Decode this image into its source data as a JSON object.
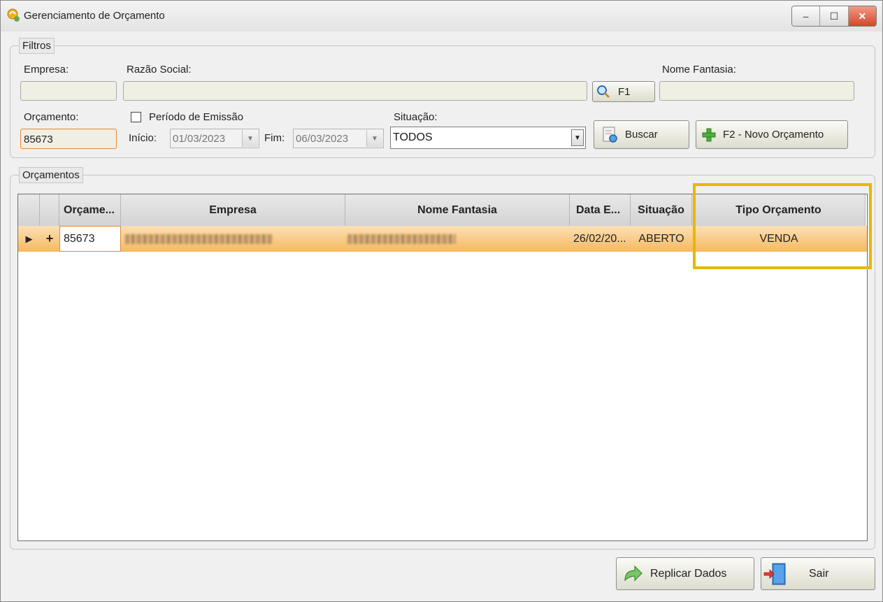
{
  "window": {
    "title": "Gerenciamento de Orçamento",
    "controls": {
      "minimize": "–",
      "maximize": "☐",
      "close": "✕"
    }
  },
  "filtros": {
    "legend": "Filtros",
    "empresa_label": "Empresa:",
    "empresa_value": "",
    "razao_social_label": "Razão Social:",
    "razao_social_value": "",
    "search_button_label": "F1",
    "nome_fantasia_label": "Nome Fantasia:",
    "nome_fantasia_value": "",
    "orcamento_label": "Orçamento:",
    "orcamento_value": "85673",
    "periodo_label": "Período de Emissão",
    "periodo_checked": false,
    "inicio_label": "Início:",
    "inicio_value": "01/03/2023",
    "fim_label": "Fim:",
    "fim_value": "06/03/2023",
    "situacao_label": "Situação:",
    "situacao_value": "TODOS",
    "buscar_label": "Buscar",
    "novo_label": "F2 - Novo Orçamento"
  },
  "orcamentos": {
    "legend": "Orçamentos",
    "columns": [
      "Orçame...",
      "Empresa",
      "Nome Fantasia",
      "Data E...",
      "Situação",
      "Tipo Orçamento"
    ],
    "rows": [
      {
        "expand": "+",
        "orcamento": "85673",
        "empresa": "",
        "nome_fantasia": "",
        "data": "26/02/20...",
        "situacao": "ABERTO",
        "tipo": "VENDA"
      }
    ]
  },
  "footer": {
    "replicar_label": "Replicar Dados",
    "sair_label": "Sair"
  },
  "colors": {
    "highlight": "#e6b800",
    "selected_row": "#f5b960",
    "focus_border": "#e0883a"
  }
}
